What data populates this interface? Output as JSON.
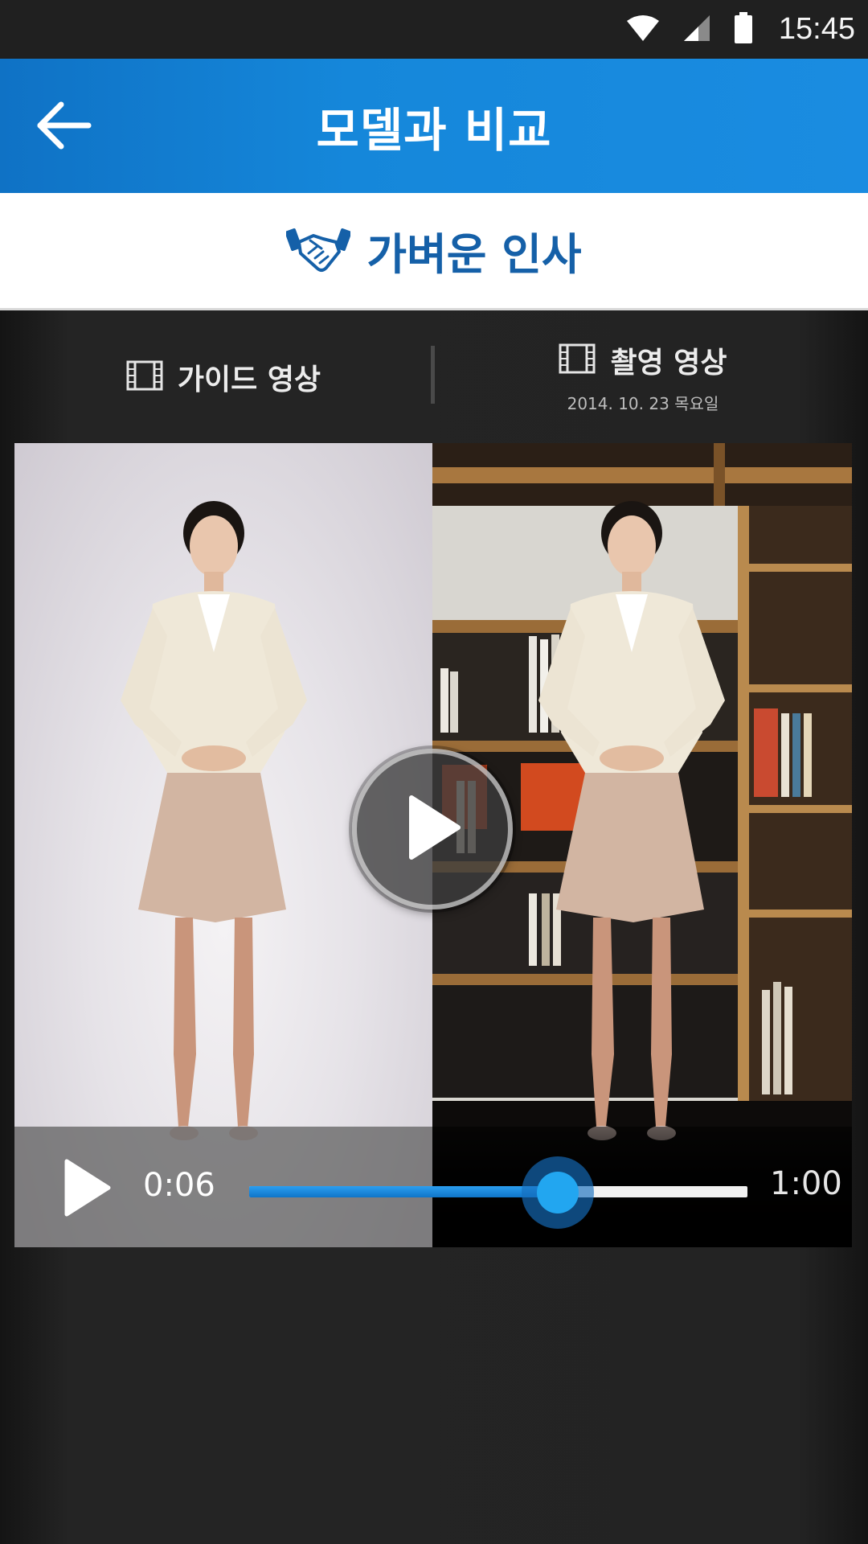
{
  "status_bar": {
    "time": "15:45",
    "icons": [
      "wifi-icon",
      "cell-signal-icon",
      "battery-icon"
    ]
  },
  "app_bar": {
    "title": "모델과 비교",
    "back_icon": "arrow-left-icon",
    "color": "#1587da"
  },
  "subject": {
    "icon": "handshake-icon",
    "title": "가벼운 인사",
    "color": "#1560a8"
  },
  "tabs": {
    "guide": {
      "label": "가이드 영상",
      "icon": "film-icon"
    },
    "recorded": {
      "label": "촬영 영상",
      "icon": "film-icon",
      "date": "2014. 10. 23 목요일"
    }
  },
  "player": {
    "current_time": "0:06",
    "total_time": "1:00",
    "progress": 0.62,
    "accent": "#22a6f0"
  }
}
